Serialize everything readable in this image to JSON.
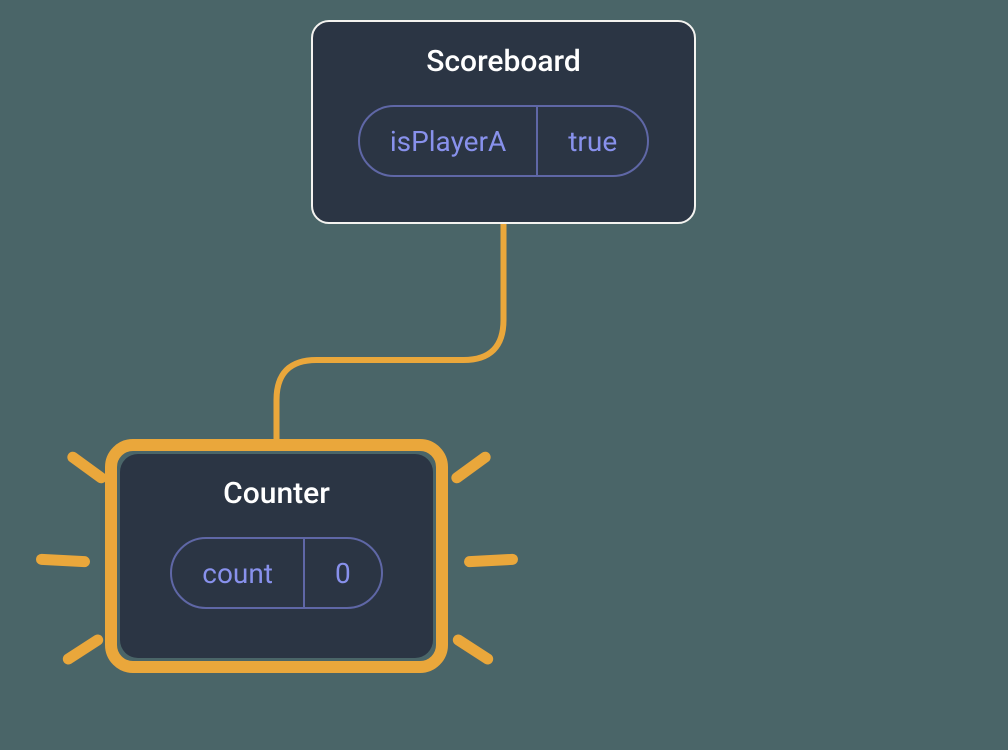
{
  "diagram": {
    "parent": {
      "title": "Scoreboard",
      "state": {
        "key": "isPlayerA",
        "value": "true"
      }
    },
    "child": {
      "title": "Counter",
      "state": {
        "key": "count",
        "value": "0"
      },
      "highlighted": true
    },
    "colors": {
      "background": "#4a6568",
      "node_fill": "#2b3544",
      "node_border": "#f4f3f0",
      "pill_border": "#5f67a6",
      "pill_text": "#8891ec",
      "accent": "#eaa73b",
      "title_text": "#ffffff"
    }
  }
}
